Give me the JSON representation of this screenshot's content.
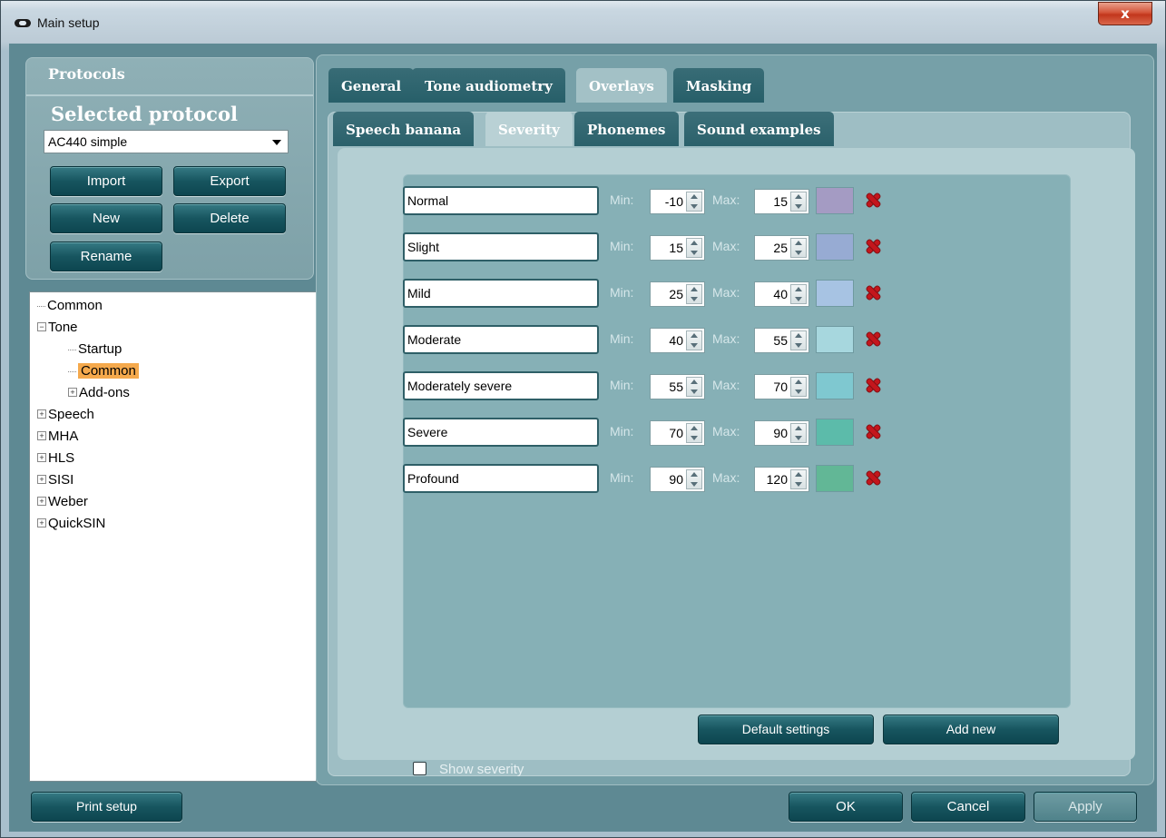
{
  "window": {
    "title": "Main setup",
    "close_glyph": "x"
  },
  "left": {
    "protocols_title": "Protocols",
    "selected_title": "Selected protocol",
    "protocol_select": "AC440 simple",
    "buttons": {
      "import": "Import",
      "export": "Export",
      "new": "New",
      "delete": "Delete",
      "rename": "Rename"
    },
    "tree": [
      {
        "label": "Common",
        "depth": 0,
        "expander": "none"
      },
      {
        "label": "Tone",
        "depth": 0,
        "expander": "minus"
      },
      {
        "label": "Startup",
        "depth": 1,
        "expander": "none"
      },
      {
        "label": "Common",
        "depth": 1,
        "expander": "none",
        "selected": true
      },
      {
        "label": "Add-ons",
        "depth": 1,
        "expander": "plus"
      },
      {
        "label": "Speech",
        "depth": 0,
        "expander": "plus"
      },
      {
        "label": "MHA",
        "depth": 0,
        "expander": "plus"
      },
      {
        "label": "HLS",
        "depth": 0,
        "expander": "plus"
      },
      {
        "label": "SISI",
        "depth": 0,
        "expander": "plus"
      },
      {
        "label": "Weber",
        "depth": 0,
        "expander": "plus"
      },
      {
        "label": "QuickSIN",
        "depth": 0,
        "expander": "plus"
      }
    ]
  },
  "tabs": [
    "General",
    "Tone audiometry",
    "Overlays",
    "Masking"
  ],
  "active_tab": "Overlays",
  "subtabs": [
    "Speech banana",
    "Severity",
    "Phonemes",
    "Sound examples"
  ],
  "active_subtab": "Severity",
  "severity": {
    "min_label": "Min:",
    "max_label": "Max:",
    "rows": [
      {
        "name": "Normal",
        "min": "-10",
        "max": "15",
        "color": "#a49bc3"
      },
      {
        "name": "Slight",
        "min": "15",
        "max": "25",
        "color": "#97abd3"
      },
      {
        "name": "Mild",
        "min": "25",
        "max": "40",
        "color": "#a7c3e3"
      },
      {
        "name": "Moderate",
        "min": "40",
        "max": "55",
        "color": "#a7d7de"
      },
      {
        "name": "Moderately severe",
        "min": "55",
        "max": "70",
        "color": "#7fc8d0"
      },
      {
        "name": "Severe",
        "min": "70",
        "max": "90",
        "color": "#5cbbaa"
      },
      {
        "name": "Profound",
        "min": "90",
        "max": "120",
        "color": "#62b796"
      }
    ],
    "show_severity_label": "Show severity",
    "show_severity_checked": false,
    "default_settings": "Default settings",
    "add_new": "Add new"
  },
  "footer": {
    "print_setup": "Print setup",
    "ok": "OK",
    "cancel": "Cancel",
    "apply": "Apply"
  }
}
